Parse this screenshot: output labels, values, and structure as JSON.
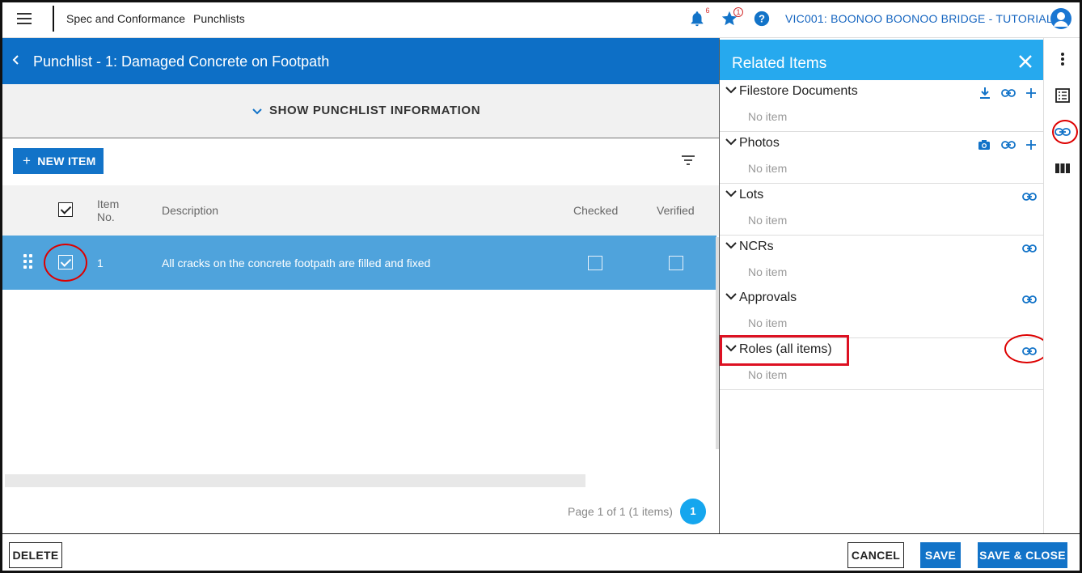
{
  "topbar": {
    "breadcrumb": [
      "Spec and Conformance",
      "Punchlists"
    ],
    "notifications_count": "6",
    "favorites_count": "1",
    "project": "VIC001: BOONOO BOONOO BRIDGE - TUTORIAL"
  },
  "header": {
    "title": "Punchlist - 1: Damaged Concrete on Footpath",
    "show_info": "SHOW PUNCHLIST INFORMATION"
  },
  "toolbar": {
    "new_item": "NEW ITEM"
  },
  "table": {
    "columns": {
      "item_no": "Item No.",
      "description": "Description",
      "checked": "Checked",
      "verified": "Verified"
    },
    "rows": [
      {
        "item_no": "1",
        "description": "All cracks on the concrete footpath are filled and fixed",
        "selected": true,
        "checked": false,
        "verified": false
      }
    ]
  },
  "pager": {
    "text": "Page 1 of 1 (1 items)",
    "current": "1"
  },
  "related": {
    "title": "Related Items",
    "sections": [
      {
        "title": "Filestore Documents",
        "empty": "No item",
        "actions": [
          "download-icon",
          "link-icon",
          "add-icon"
        ]
      },
      {
        "title": "Photos",
        "empty": "No item",
        "actions": [
          "camera-icon",
          "link-icon",
          "add-icon"
        ]
      },
      {
        "title": "Lots",
        "empty": "No item",
        "actions": [
          "link-icon"
        ]
      },
      {
        "title": "NCRs",
        "empty": "No item",
        "actions": [
          "link-icon"
        ]
      },
      {
        "title": "Approvals",
        "empty": "No item",
        "actions": [
          "link-icon"
        ]
      },
      {
        "title": "Roles (all items)",
        "empty": "No item",
        "actions": [
          "link-icon"
        ]
      }
    ]
  },
  "footer": {
    "delete": "DELETE",
    "cancel": "CANCEL",
    "save": "SAVE",
    "save_close": "SAVE & CLOSE"
  },
  "colors": {
    "primary": "#0d6fc6",
    "panel_header": "#26a9ee",
    "selected_row": "#4fa3dc",
    "annotation": "#dd0000"
  }
}
